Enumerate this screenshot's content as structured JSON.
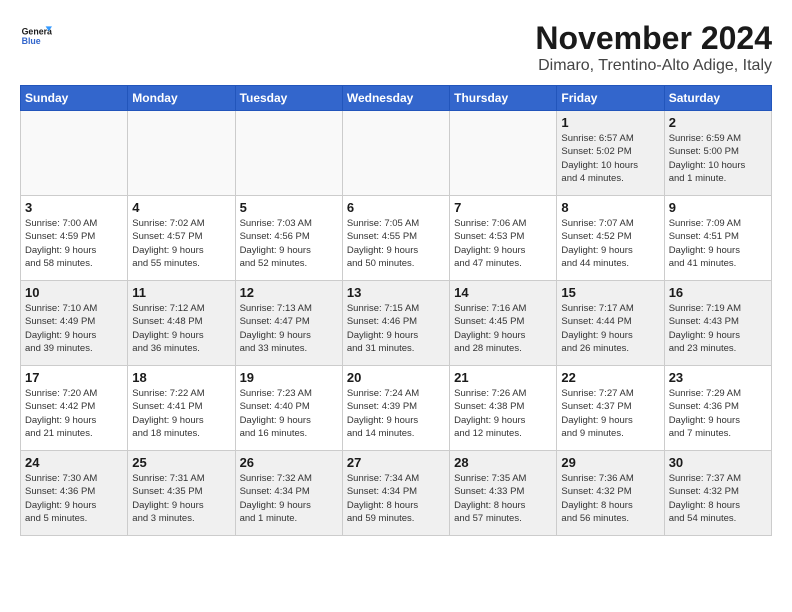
{
  "logo": {
    "line1": "General",
    "line2": "Blue"
  },
  "title": "November 2024",
  "subtitle": "Dimaro, Trentino-Alto Adige, Italy",
  "days_of_week": [
    "Sunday",
    "Monday",
    "Tuesday",
    "Wednesday",
    "Thursday",
    "Friday",
    "Saturday"
  ],
  "weeks": [
    [
      {
        "day": "",
        "info": "",
        "empty": true
      },
      {
        "day": "",
        "info": "",
        "empty": true
      },
      {
        "day": "",
        "info": "",
        "empty": true
      },
      {
        "day": "",
        "info": "",
        "empty": true
      },
      {
        "day": "",
        "info": "",
        "empty": true
      },
      {
        "day": "1",
        "info": "Sunrise: 6:57 AM\nSunset: 5:02 PM\nDaylight: 10 hours\nand 4 minutes."
      },
      {
        "day": "2",
        "info": "Sunrise: 6:59 AM\nSunset: 5:00 PM\nDaylight: 10 hours\nand 1 minute."
      }
    ],
    [
      {
        "day": "3",
        "info": "Sunrise: 7:00 AM\nSunset: 4:59 PM\nDaylight: 9 hours\nand 58 minutes."
      },
      {
        "day": "4",
        "info": "Sunrise: 7:02 AM\nSunset: 4:57 PM\nDaylight: 9 hours\nand 55 minutes."
      },
      {
        "day": "5",
        "info": "Sunrise: 7:03 AM\nSunset: 4:56 PM\nDaylight: 9 hours\nand 52 minutes."
      },
      {
        "day": "6",
        "info": "Sunrise: 7:05 AM\nSunset: 4:55 PM\nDaylight: 9 hours\nand 50 minutes."
      },
      {
        "day": "7",
        "info": "Sunrise: 7:06 AM\nSunset: 4:53 PM\nDaylight: 9 hours\nand 47 minutes."
      },
      {
        "day": "8",
        "info": "Sunrise: 7:07 AM\nSunset: 4:52 PM\nDaylight: 9 hours\nand 44 minutes."
      },
      {
        "day": "9",
        "info": "Sunrise: 7:09 AM\nSunset: 4:51 PM\nDaylight: 9 hours\nand 41 minutes."
      }
    ],
    [
      {
        "day": "10",
        "info": "Sunrise: 7:10 AM\nSunset: 4:49 PM\nDaylight: 9 hours\nand 39 minutes."
      },
      {
        "day": "11",
        "info": "Sunrise: 7:12 AM\nSunset: 4:48 PM\nDaylight: 9 hours\nand 36 minutes."
      },
      {
        "day": "12",
        "info": "Sunrise: 7:13 AM\nSunset: 4:47 PM\nDaylight: 9 hours\nand 33 minutes."
      },
      {
        "day": "13",
        "info": "Sunrise: 7:15 AM\nSunset: 4:46 PM\nDaylight: 9 hours\nand 31 minutes."
      },
      {
        "day": "14",
        "info": "Sunrise: 7:16 AM\nSunset: 4:45 PM\nDaylight: 9 hours\nand 28 minutes."
      },
      {
        "day": "15",
        "info": "Sunrise: 7:17 AM\nSunset: 4:44 PM\nDaylight: 9 hours\nand 26 minutes."
      },
      {
        "day": "16",
        "info": "Sunrise: 7:19 AM\nSunset: 4:43 PM\nDaylight: 9 hours\nand 23 minutes."
      }
    ],
    [
      {
        "day": "17",
        "info": "Sunrise: 7:20 AM\nSunset: 4:42 PM\nDaylight: 9 hours\nand 21 minutes."
      },
      {
        "day": "18",
        "info": "Sunrise: 7:22 AM\nSunset: 4:41 PM\nDaylight: 9 hours\nand 18 minutes."
      },
      {
        "day": "19",
        "info": "Sunrise: 7:23 AM\nSunset: 4:40 PM\nDaylight: 9 hours\nand 16 minutes."
      },
      {
        "day": "20",
        "info": "Sunrise: 7:24 AM\nSunset: 4:39 PM\nDaylight: 9 hours\nand 14 minutes."
      },
      {
        "day": "21",
        "info": "Sunrise: 7:26 AM\nSunset: 4:38 PM\nDaylight: 9 hours\nand 12 minutes."
      },
      {
        "day": "22",
        "info": "Sunrise: 7:27 AM\nSunset: 4:37 PM\nDaylight: 9 hours\nand 9 minutes."
      },
      {
        "day": "23",
        "info": "Sunrise: 7:29 AM\nSunset: 4:36 PM\nDaylight: 9 hours\nand 7 minutes."
      }
    ],
    [
      {
        "day": "24",
        "info": "Sunrise: 7:30 AM\nSunset: 4:36 PM\nDaylight: 9 hours\nand 5 minutes."
      },
      {
        "day": "25",
        "info": "Sunrise: 7:31 AM\nSunset: 4:35 PM\nDaylight: 9 hours\nand 3 minutes."
      },
      {
        "day": "26",
        "info": "Sunrise: 7:32 AM\nSunset: 4:34 PM\nDaylight: 9 hours\nand 1 minute."
      },
      {
        "day": "27",
        "info": "Sunrise: 7:34 AM\nSunset: 4:34 PM\nDaylight: 8 hours\nand 59 minutes."
      },
      {
        "day": "28",
        "info": "Sunrise: 7:35 AM\nSunset: 4:33 PM\nDaylight: 8 hours\nand 57 minutes."
      },
      {
        "day": "29",
        "info": "Sunrise: 7:36 AM\nSunset: 4:32 PM\nDaylight: 8 hours\nand 56 minutes."
      },
      {
        "day": "30",
        "info": "Sunrise: 7:37 AM\nSunset: 4:32 PM\nDaylight: 8 hours\nand 54 minutes."
      }
    ]
  ]
}
